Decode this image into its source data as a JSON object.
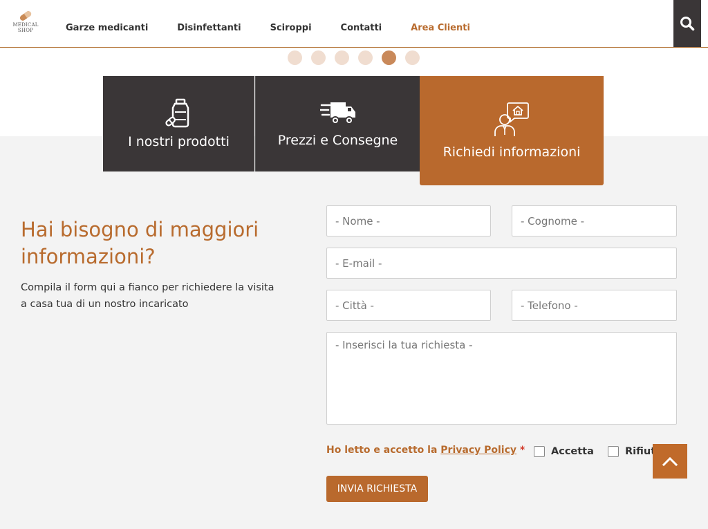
{
  "header": {
    "logo_line1": "MEDICAL",
    "logo_line2": "SHOP",
    "nav": [
      "Garze medicanti",
      "Disinfettanti",
      "Sciroppi",
      "Contatti",
      "Area Clienti"
    ],
    "search_icon": "search-icon"
  },
  "carousel": {
    "dot_count": 6,
    "active_index": 4
  },
  "tabs": [
    {
      "label": "I nostri prodotti",
      "icon": "medicine-bottle-icon"
    },
    {
      "label": "Prezzi e Consegne",
      "icon": "delivery-truck-icon"
    },
    {
      "label": "Richiedi informazioni",
      "icon": "user-house-chat-icon"
    }
  ],
  "info": {
    "title": "Hai bisogno di maggiori informazioni?",
    "description": "Compila il form qui a fianco per richiedere la visita a casa tua di un nostro incaricato"
  },
  "form": {
    "nome_placeholder": "- Nome -",
    "cognome_placeholder": "- Cognome -",
    "email_placeholder": "- E-mail -",
    "citta_placeholder": "- Città -",
    "telefono_placeholder": "- Telefono -",
    "richiesta_placeholder": "- Inserisci la tua richiesta -",
    "privacy_prefix": "Ho letto e accetto la ",
    "privacy_link": "Privacy Policy",
    "required_mark": "*",
    "accept_label": "Accetta",
    "reject_label": "Rifiuta",
    "submit_label": "INVIA RICHIESTA"
  },
  "colors": {
    "accent": "#b9692d",
    "dark": "#3a3637",
    "dot_inactive": "#f0ddd0",
    "dot_active": "#c9895a"
  },
  "scroll_top_icon": "chevron-up-icon"
}
